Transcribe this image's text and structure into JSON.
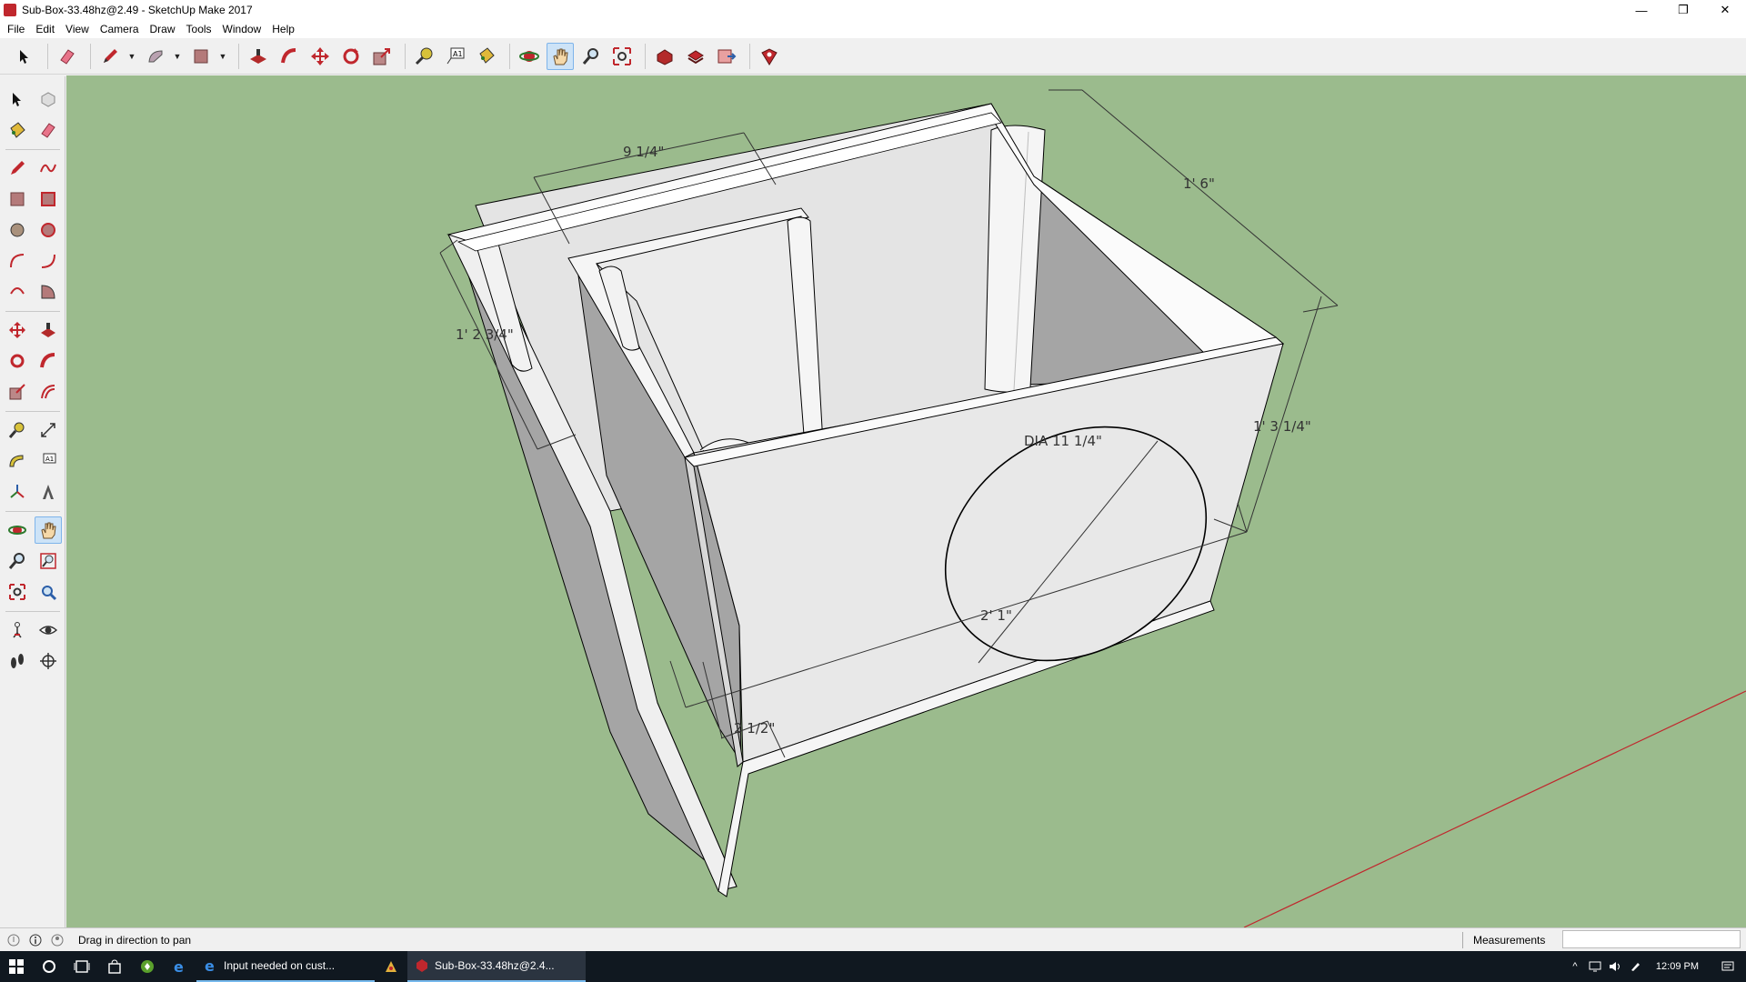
{
  "window": {
    "title": "Sub-Box-33.48hz@2.49 - SketchUp Make 2017",
    "controls": [
      "—",
      "❐",
      "✕"
    ]
  },
  "menu": [
    "File",
    "Edit",
    "View",
    "Camera",
    "Draw",
    "Tools",
    "Window",
    "Help"
  ],
  "toolbar": {
    "groups": [
      [
        "select-icon",
        "eraser-icon",
        "pencil-icon",
        "freehand-icon",
        "rectangle-icon"
      ],
      [
        "push-pull-icon",
        "follow-me-icon",
        "move-icon",
        "rotate-icon",
        "scale-icon"
      ],
      [
        "tape-measure-icon",
        "text-icon",
        "paint-bucket-icon"
      ],
      [
        "orbit-icon",
        "pan-icon",
        "zoom-icon",
        "zoom-extents-icon"
      ],
      [
        "warehouse-icon",
        "extension-warehouse-icon",
        "send-to-layout-icon"
      ],
      [
        "extension-manager-icon"
      ]
    ],
    "active": "pan-icon"
  },
  "model": {
    "dimensions": {
      "top_width": "9 1/4\"",
      "depth": "1' 6\"",
      "left_height": "1' 2 3/4\"",
      "front_height": "1' 3 1/4\"",
      "port_diameter": "DIA 11 1/4\"",
      "front_width": "2' 1\"",
      "slot_width": "2 1/2\""
    },
    "colors": {
      "background": "#9bbb8d",
      "panel_light": "#e6e6e6",
      "panel_top": "#ffffff",
      "panel_shadow": "#a6a6a6",
      "axis_red": "#c0272d"
    }
  },
  "status": {
    "hint": "Drag in direction to pan",
    "measurements_label": "Measurements",
    "measurements_value": ""
  },
  "taskbar": {
    "apps": [
      {
        "label": "Input needed on cust...",
        "state": "open"
      },
      {
        "label": "Sub-Box-33.48hz@2.4...",
        "state": "active"
      }
    ],
    "clock": "12:09 PM"
  }
}
